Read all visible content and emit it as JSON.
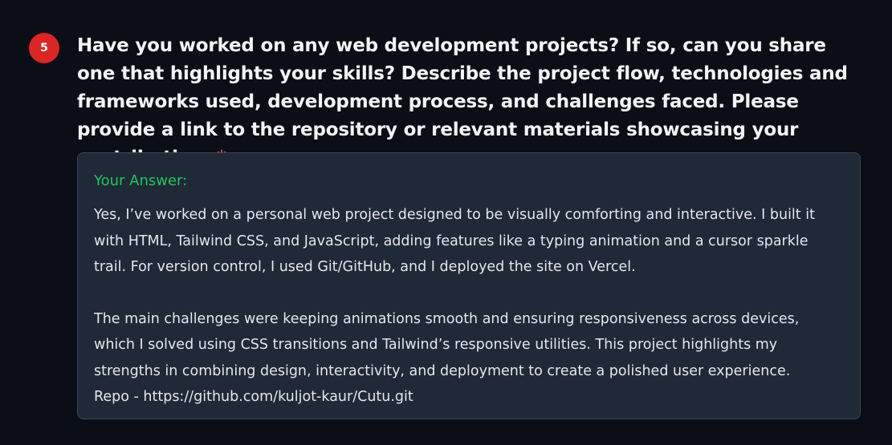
{
  "question": {
    "number": "5",
    "text": "Have you worked on any web development projects? If so, can you share one that highlights your skills? Describe the project flow, technologies and frameworks used, development process, and challenges faced. Please provide a link to the repository or relevant materials showcasing your contribution.",
    "required_marker": "*"
  },
  "answer": {
    "label": "Your Answer:",
    "paragraph_1": "Yes, I’ve worked on a personal web project designed to be visually comforting and interactive. I built it with HTML, Tailwind CSS, and JavaScript, adding features like a typing animation and a cursor sparkle trail. For version control, I used Git/GitHub, and I deployed the site on Vercel.",
    "paragraph_2": "The main challenges were keeping animations smooth and ensuring responsiveness across devices, which I solved using CSS transitions and Tailwind’s responsive utilities. This project highlights my strengths in combining design, interactivity, and deployment to create a polished user experience.",
    "repo_line": "Repo - https://github.com/kuljot-kaur/Cutu.git"
  },
  "colors": {
    "background": "#0b0e16",
    "badge": "#dc2626",
    "required": "#ef4444",
    "answer_label": "#22c55e",
    "card_background": "#1f2937",
    "card_border": "#3c4656"
  }
}
